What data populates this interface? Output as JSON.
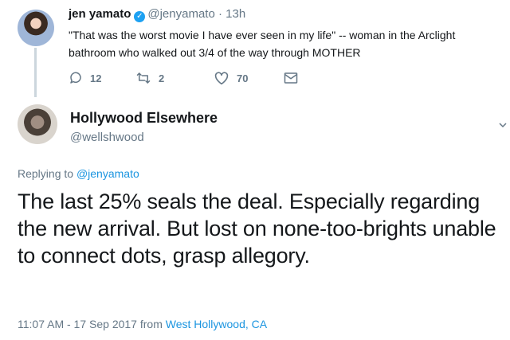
{
  "parent_tweet": {
    "name": "jen yamato",
    "handle": "@jenyamato",
    "separator": "·",
    "time": "13h",
    "text": "\"That was the worst movie I have ever seen in my life\" -- woman in the Arclight bathroom who walked out 3/4 of the way through MOTHER",
    "replies": "12",
    "retweets": "2",
    "likes": "70",
    "verified_glyph": "✓"
  },
  "main_tweet": {
    "name": "Hollywood Elsewhere",
    "handle": "@wellshwood",
    "replying_prefix": "Replying to",
    "replying_to": "@jenyamato",
    "text": "The last 25% seals the deal.  Especially regarding the new arrival.  But lost on none-too-brights unable to connect dots, grasp allegory.",
    "timestamp": "11:07 AM - 17 Sep 2017 from",
    "location": "West Hollywood, CA"
  },
  "icons": {
    "reply": "reply-icon",
    "retweet": "retweet-icon",
    "like": "heart-icon",
    "dm": "envelope-icon",
    "verified": "verified-badge-icon",
    "caret": "chevron-down-icon"
  },
  "colors": {
    "text": "#14171a",
    "muted": "#657786",
    "link": "#1b95e0",
    "verified": "#1da1f2",
    "thread_line": "#ccd6dd"
  }
}
